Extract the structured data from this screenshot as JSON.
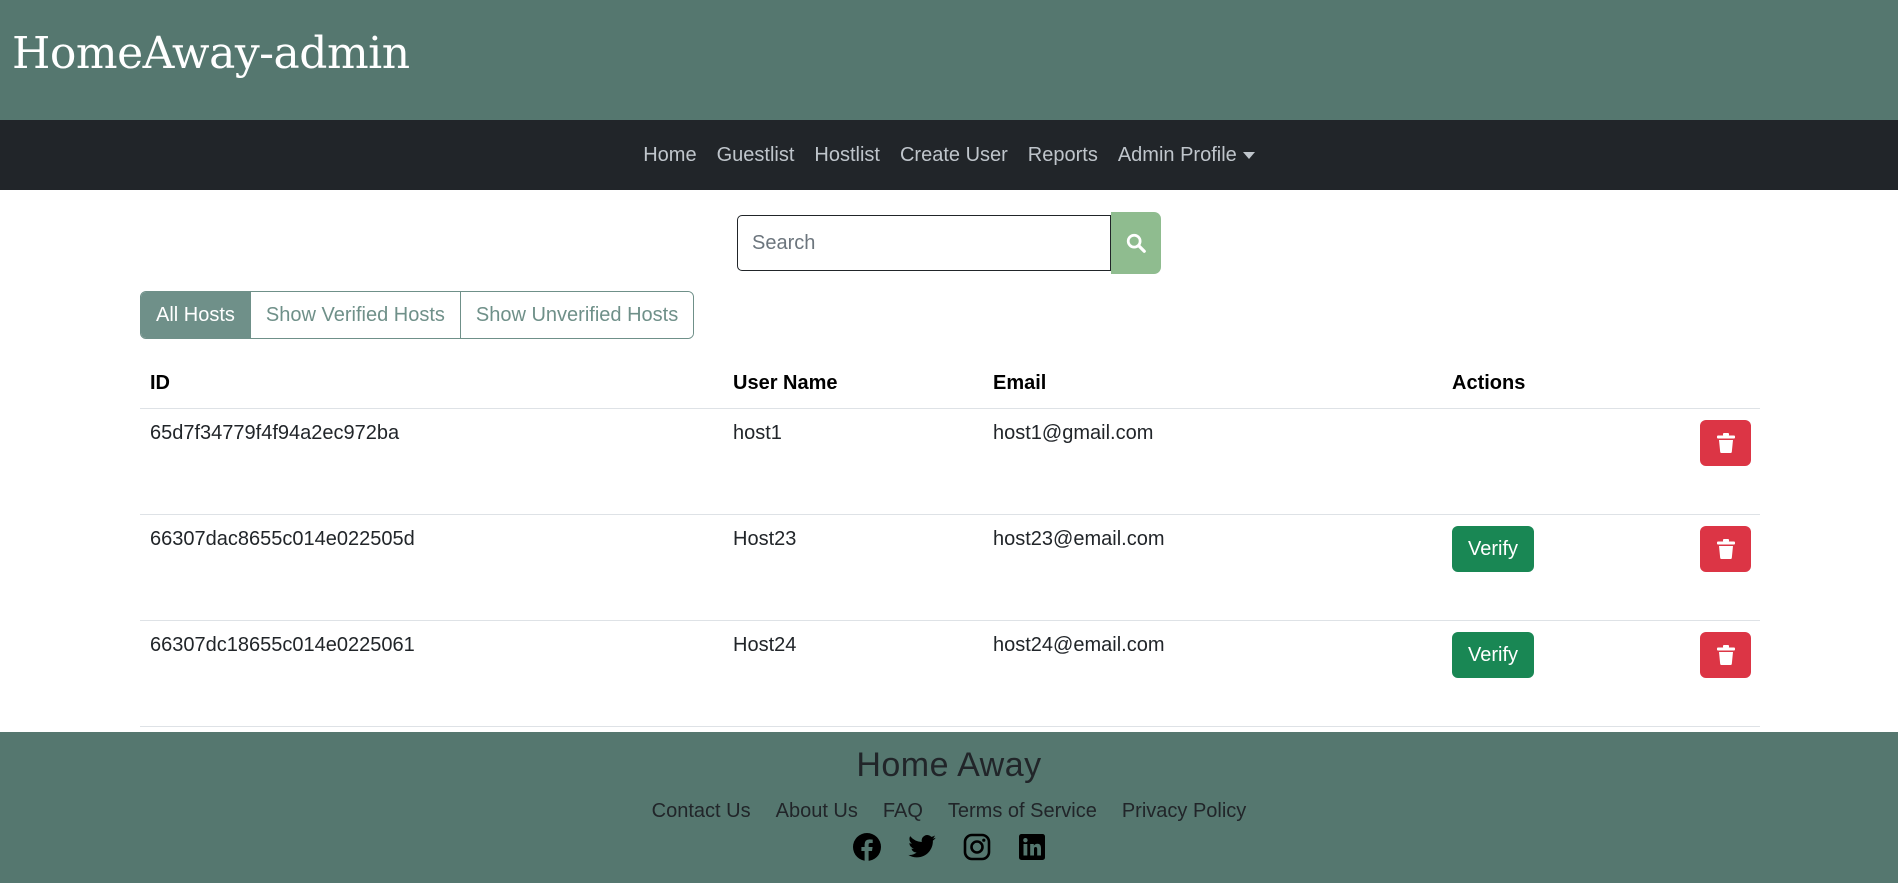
{
  "brand": {
    "title": "HomeAway-admin"
  },
  "nav": {
    "items": [
      "Home",
      "Guestlist",
      "Hostlist",
      "Create User",
      "Reports"
    ],
    "profile_label": "Admin Profile"
  },
  "search": {
    "placeholder": "Search",
    "value": ""
  },
  "filters": [
    "All Hosts",
    "Show Verified Hosts",
    "Show Unverified Hosts"
  ],
  "table": {
    "headers": {
      "id": "ID",
      "user": "User Name",
      "email": "Email",
      "actions": "Actions"
    },
    "rows": [
      {
        "id": "65d7f34779f4f94a2ec972ba",
        "user": "host1",
        "email": "host1@gmail.com",
        "verify": ""
      },
      {
        "id": "66307dac8655c014e022505d",
        "user": "Host23",
        "email": "host23@email.com",
        "verify": "Verify"
      },
      {
        "id": "66307dc18655c014e0225061",
        "user": "Host24",
        "email": "host24@email.com",
        "verify": "Verify"
      }
    ]
  },
  "footer": {
    "title": "Home Away",
    "links": [
      "Contact Us",
      "About Us",
      "FAQ",
      "Terms of Service",
      "Privacy Policy"
    ],
    "socials": [
      "facebook-icon",
      "twitter-icon",
      "instagram-icon",
      "linkedin-icon"
    ]
  },
  "colors": {
    "brand_bg": "#55776f",
    "nav_bg": "#212529",
    "accent": "#6f9089",
    "search_btn": "#8fbc8f",
    "verify": "#198754",
    "delete": "#dc3545"
  }
}
